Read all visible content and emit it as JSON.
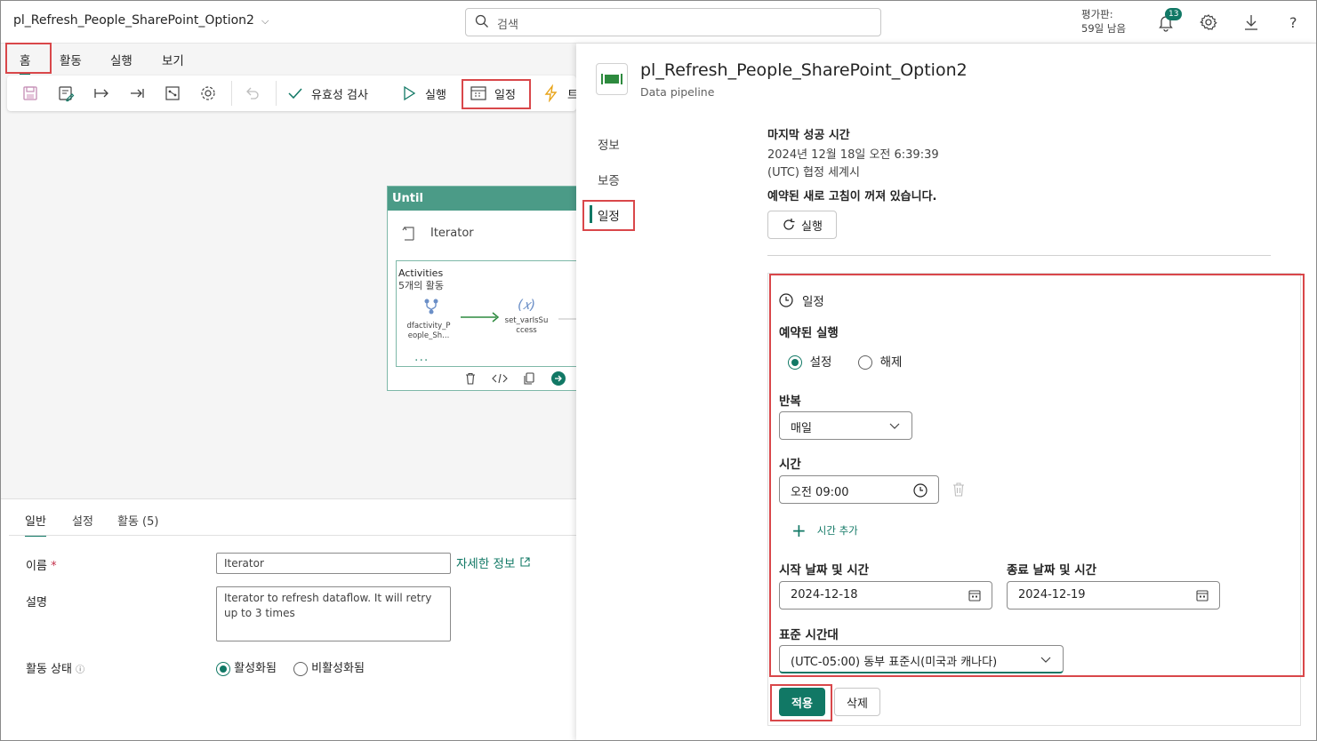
{
  "topbar": {
    "title": "pl_Refresh_People_SharePoint_Option2",
    "search_placeholder": "검색",
    "trial_line1": "평가판:",
    "trial_line2": "59일 남음",
    "notification_count": "13"
  },
  "menu_tabs": [
    "홈",
    "활동",
    "실행",
    "보기"
  ],
  "toolbar": {
    "validate": "유효성 검사",
    "run": "실행",
    "schedule": "일정",
    "trigger_partial": "트"
  },
  "canvas": {
    "until_label": "Until",
    "iterator_label": "Iterator",
    "activities_title": "Activities",
    "activities_count": "5개의 활동",
    "act1_line1": "dfactivity_P",
    "act1_line2": "eople_Sh...",
    "act2_line1": "set_varIsSu",
    "act2_line2": "ccess",
    "act2_symbol": "(𝑥)",
    "more": "..."
  },
  "bottom": {
    "tabs": [
      "일반",
      "설정",
      "활동 (5)"
    ],
    "name_label": "이름",
    "name_value": "Iterator",
    "more_info": "자세한 정보",
    "desc_label": "설명",
    "desc_value": "Iterator to refresh dataflow. It will retry up to 3 times",
    "state_label": "활동 상태",
    "state_on": "활성화됨",
    "state_off": "비활성화됨"
  },
  "panel": {
    "title": "pl_Refresh_People_SharePoint_Option2",
    "subtitle": "Data pipeline",
    "nav": [
      "정보",
      "보증",
      "일정"
    ],
    "last_success_label": "마지막 성공 시간",
    "last_success_value": "2024년 12월 18일 오전 6:39:39",
    "timezone_note": "(UTC) 협정 세계시",
    "refresh_off": "예약된 새로 고침이 꺼져 있습니다.",
    "run_button": "실행",
    "schedule_header": "일정",
    "scheduled_run_label": "예약된 실행",
    "opt_on": "설정",
    "opt_off": "해제",
    "repeat_label": "반복",
    "repeat_value": "매일",
    "time_label": "시간",
    "time_value": "오전 09:00",
    "add_time": "시간 추가",
    "start_label": "시작 날짜 및 시간",
    "start_value": "2024-12-18",
    "end_label": "종료 날짜 및 시간",
    "end_value": "2024-12-19",
    "tz_label": "표준 시간대",
    "tz_value": "(UTC-05:00) 동부 표준시(미국과 캐나다)",
    "apply": "적용",
    "delete": "삭제"
  },
  "colors": {
    "accent": "#117865",
    "highlight": "#d9474a",
    "until_header": "#4b9b87"
  }
}
